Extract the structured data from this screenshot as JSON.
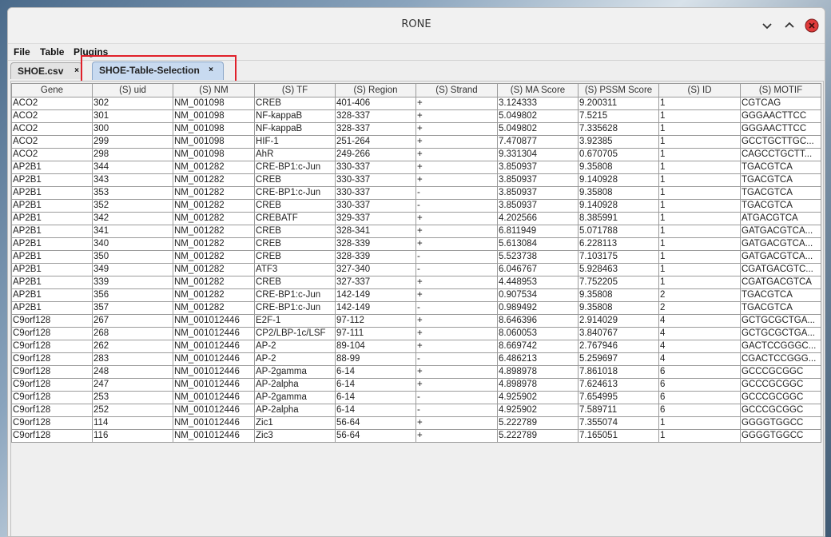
{
  "window": {
    "title": "RONE"
  },
  "menu": [
    "File",
    "Table",
    "Plugins"
  ],
  "tabs": [
    {
      "label": "SHOE.csv",
      "close": "×"
    },
    {
      "label": "SHOE-Table-Selection",
      "close": "×"
    }
  ],
  "table": {
    "columns": [
      "Gene",
      "(S) uid",
      "(S) NM",
      "(S) TF",
      "(S) Region",
      "(S) Strand",
      "(S) MA Score",
      "(S) PSSM Score",
      "(S) ID",
      "(S) MOTIF"
    ],
    "rows": [
      [
        "ACO2",
        "302",
        "NM_001098",
        "CREB",
        "401-406",
        "+",
        "3.124333",
        "9.200311",
        "1",
        "CGTCAG"
      ],
      [
        "ACO2",
        "301",
        "NM_001098",
        "NF-kappaB",
        "328-337",
        "+",
        "5.049802",
        "7.5215",
        "1",
        "GGGAACTTCC"
      ],
      [
        "ACO2",
        "300",
        "NM_001098",
        "NF-kappaB",
        "328-337",
        "+",
        "5.049802",
        "7.335628",
        "1",
        "GGGAACTTCC"
      ],
      [
        "ACO2",
        "299",
        "NM_001098",
        "HIF-1",
        "251-264",
        "+",
        "7.470877",
        "3.92385",
        "1",
        "GCCTGCTTGC..."
      ],
      [
        "ACO2",
        "298",
        "NM_001098",
        "AhR",
        "249-266",
        "+",
        "9.331304",
        "0.670705",
        "1",
        "CAGCCTGCTT..."
      ],
      [
        "AP2B1",
        "344",
        "NM_001282",
        "CRE-BP1:c-Jun",
        "330-337",
        "+",
        "3.850937",
        "9.35808",
        "1",
        "TGACGTCA"
      ],
      [
        "AP2B1",
        "343",
        "NM_001282",
        "CREB",
        "330-337",
        "+",
        "3.850937",
        "9.140928",
        "1",
        "TGACGTCA"
      ],
      [
        "AP2B1",
        "353",
        "NM_001282",
        "CRE-BP1:c-Jun",
        "330-337",
        "-",
        "3.850937",
        "9.35808",
        "1",
        "TGACGTCA"
      ],
      [
        "AP2B1",
        "352",
        "NM_001282",
        "CREB",
        "330-337",
        "-",
        "3.850937",
        "9.140928",
        "1",
        "TGACGTCA"
      ],
      [
        "AP2B1",
        "342",
        "NM_001282",
        "CREBATF",
        "329-337",
        "+",
        "4.202566",
        "8.385991",
        "1",
        "ATGACGTCA"
      ],
      [
        "AP2B1",
        "341",
        "NM_001282",
        "CREB",
        "328-341",
        "+",
        "6.811949",
        "5.071788",
        "1",
        "GATGACGTCA..."
      ],
      [
        "AP2B1",
        "340",
        "NM_001282",
        "CREB",
        "328-339",
        "+",
        "5.613084",
        "6.228113",
        "1",
        "GATGACGTCA..."
      ],
      [
        "AP2B1",
        "350",
        "NM_001282",
        "CREB",
        "328-339",
        "-",
        "5.523738",
        "7.103175",
        "1",
        "GATGACGTCA..."
      ],
      [
        "AP2B1",
        "349",
        "NM_001282",
        "ATF3",
        "327-340",
        "-",
        "6.046767",
        "5.928463",
        "1",
        "CGATGACGTC..."
      ],
      [
        "AP2B1",
        "339",
        "NM_001282",
        "CREB",
        "327-337",
        "+",
        "4.448953",
        "7.752205",
        "1",
        "CGATGACGTCA"
      ],
      [
        "AP2B1",
        "356",
        "NM_001282",
        "CRE-BP1:c-Jun",
        "142-149",
        "+",
        "0.907534",
        "9.35808",
        "2",
        "TGACGTCA"
      ],
      [
        "AP2B1",
        "357",
        "NM_001282",
        "CRE-BP1:c-Jun",
        "142-149",
        "-",
        "0.989492",
        "9.35808",
        "2",
        "TGACGTCA"
      ],
      [
        "C9orf128",
        "267",
        "NM_001012446",
        "E2F-1",
        "97-112",
        "+",
        "8.646396",
        "2.914029",
        "4",
        "GCTGCGCTGA..."
      ],
      [
        "C9orf128",
        "268",
        "NM_001012446",
        "CP2/LBP-1c/LSF",
        "97-111",
        "+",
        "8.060053",
        "3.840767",
        "4",
        "GCTGCGCTGA..."
      ],
      [
        "C9orf128",
        "262",
        "NM_001012446",
        "AP-2",
        "89-104",
        "+",
        "8.669742",
        "2.767946",
        "4",
        "GACTCCGGGC..."
      ],
      [
        "C9orf128",
        "283",
        "NM_001012446",
        "AP-2",
        "88-99",
        "-",
        "6.486213",
        "5.259697",
        "4",
        "CGACTCCGGG..."
      ],
      [
        "C9orf128",
        "248",
        "NM_001012446",
        "AP-2gamma",
        "6-14",
        "+",
        "4.898978",
        "7.861018",
        "6",
        "GCCCGCGGC"
      ],
      [
        "C9orf128",
        "247",
        "NM_001012446",
        "AP-2alpha",
        "6-14",
        "+",
        "4.898978",
        "7.624613",
        "6",
        "GCCCGCGGC"
      ],
      [
        "C9orf128",
        "253",
        "NM_001012446",
        "AP-2gamma",
        "6-14",
        "-",
        "4.925902",
        "7.654995",
        "6",
        "GCCCGCGGC"
      ],
      [
        "C9orf128",
        "252",
        "NM_001012446",
        "AP-2alpha",
        "6-14",
        "-",
        "4.925902",
        "7.589711",
        "6",
        "GCCCGCGGC"
      ],
      [
        "C9orf128",
        "114",
        "NM_001012446",
        "Zic1",
        "56-64",
        "+",
        "5.222789",
        "7.355074",
        "1",
        "GGGGTGGCC"
      ],
      [
        "C9orf128",
        "116",
        "NM_001012446",
        "Zic3",
        "56-64",
        "+",
        "5.222789",
        "7.165051",
        "1",
        "GGGGTGGCC"
      ]
    ]
  },
  "colors": {
    "active_tab": "#c8daf0",
    "highlight": "#e0202a",
    "close_button": "#e03a3a"
  }
}
